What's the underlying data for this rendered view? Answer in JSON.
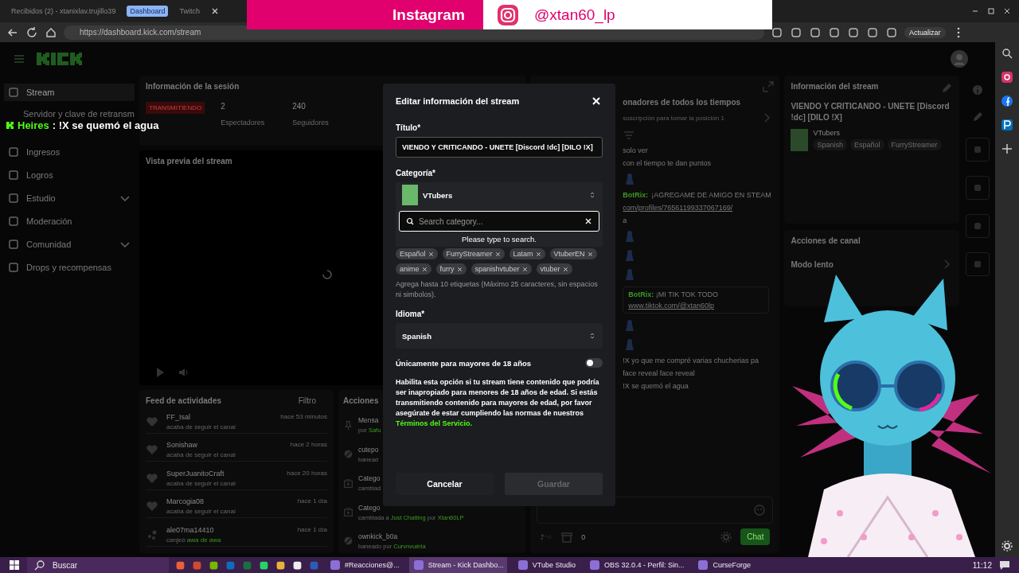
{
  "browser_tabs": [
    {
      "label": "Recibidos (2) - xtanixlav.trujillo39",
      "selected": false
    },
    {
      "label": "Dashboard",
      "selected": true
    },
    {
      "label": "Twitch",
      "selected": false
    }
  ],
  "address_bar": {
    "url": "https://dashboard.kick.com/stream"
  },
  "update_button": {
    "label": "Actualizar"
  },
  "overlay_banner": {
    "label": "Instagram",
    "handle": "@xtan60_lp"
  },
  "chat_overlay": {
    "user": "Heires",
    "message": ": !X se quemó el agua"
  },
  "sidebar": {
    "items": [
      {
        "label": "Stream",
        "selected": true,
        "submenu": false,
        "children": [
          {
            "label": "Servidor y clave de retransm"
          }
        ]
      },
      {
        "label": "Ingresos",
        "selected": false,
        "submenu": false
      },
      {
        "label": "Logros",
        "selected": false,
        "submenu": false
      },
      {
        "label": "Estudio",
        "selected": false,
        "submenu": true
      },
      {
        "label": "Moderación",
        "selected": false,
        "submenu": false
      },
      {
        "label": "Comunidad",
        "selected": false,
        "submenu": true
      },
      {
        "label": "Drops y recompensas",
        "selected": false,
        "submenu": false
      }
    ]
  },
  "session": {
    "title": "Información de la sesión",
    "status": "TRANSMITIENDO",
    "stats": [
      {
        "value": "2",
        "label": "Espectadores"
      },
      {
        "value": "240",
        "label": "Seguidores"
      }
    ]
  },
  "preview": {
    "title": "Vista previa del stream"
  },
  "feed": {
    "title": "Feed de actividades",
    "filter": "Filtro",
    "items": [
      {
        "kind": "follow",
        "user": "FF_Isal",
        "time": "hace 53 minutos",
        "detail": "acaba de seguir el canal"
      },
      {
        "kind": "follow",
        "user": "Sonishaw",
        "time": "hace 2 horas",
        "detail": "acaba de seguir el canal"
      },
      {
        "kind": "follow",
        "user": "SuperJuanitoCraft",
        "time": "hace 20 horas",
        "detail": "acaba de seguir el canal"
      },
      {
        "kind": "follow",
        "user": "Marcogia08",
        "time": "hace 1 día",
        "detail": "acaba de seguir el canal"
      },
      {
        "kind": "redeem",
        "user": "ale07ma14410",
        "time": "hace 1 día",
        "detail": "canjeó **awa de awa**"
      }
    ]
  },
  "actions": {
    "title": "Acciones",
    "items": [
      {
        "kind": "pin",
        "title": "Mensa",
        "detail": "por **Safu**"
      },
      {
        "kind": "ban",
        "title": "cutepo",
        "detail": "banead"
      },
      {
        "kind": "category",
        "title": "Catego",
        "detail": "cambiad"
      },
      {
        "kind": "category",
        "title": "Catego",
        "detail": "cambiada a **Just Chatting** por **Xtan60LP**"
      },
      {
        "kind": "ban",
        "title": "ownkick_b0a",
        "detail": "baneado por **Curvnvuéria**"
      }
    ]
  },
  "chat": {
    "header": "onadores de todos los tiempos",
    "subtitle": "suscripción para tomar la posición 1",
    "messages": [
      {
        "kind": "text",
        "text": "solo ver"
      },
      {
        "kind": "text",
        "text": "con el tiempo te dan puntos"
      },
      {
        "kind": "emote"
      },
      {
        "kind": "bot",
        "user": "BotRix:",
        "text": "¡AGREGAME DE AMIGO EN STEAM"
      },
      {
        "kind": "link",
        "text": "com/profiles/76561199337067169/"
      },
      {
        "kind": "text",
        "text": "a"
      },
      {
        "kind": "emote"
      },
      {
        "kind": "emote"
      },
      {
        "kind": "emote"
      },
      {
        "kind": "highlight",
        "user": "BotRix:",
        "text": "¡MI TIK TOK TODO",
        "link": "www.tiktok.com/@xtan60lp"
      },
      {
        "kind": "emote"
      },
      {
        "kind": "emote"
      },
      {
        "kind": "text",
        "text": "!X yo que me compré varias chucherias pa"
      },
      {
        "kind": "text",
        "text": "face reveal face reveal"
      },
      {
        "kind": "text",
        "text": "!X se quemó el agua"
      }
    ],
    "count": "0",
    "send": "Chat"
  },
  "stream_info": {
    "title": "Información del stream",
    "stream_title": "VIENDO Y CRITICANDO - UNETE [Discord !dc] [DILO !X]",
    "category": "VTubers",
    "tags": [
      "Spanish",
      "Español",
      "FurryStreamer"
    ]
  },
  "channel_actions": {
    "title": "Acciones de canal",
    "items": [
      {
        "label": "Modo lento"
      }
    ]
  },
  "modal": {
    "title": "Editar información del stream",
    "title_label": "Título*",
    "title_value": "VIENDO Y CRITICANDO - UNETE [Discord !dc] [DILO !X]",
    "category_label": "Categoría*",
    "category": "VTubers",
    "search": {
      "placeholder": "Search category...",
      "hint": "Please type to search."
    },
    "tags": [
      "Español",
      "FurryStreamer",
      "Latam",
      "VtuberEN",
      "anime",
      "furry",
      "spanishvtuber",
      "vtuber"
    ],
    "tags_help": "Agrega hasta 10 etiquetas (Máximo 25 caracteres, sin espacios ni simbolos).",
    "language_label": "Idioma*",
    "language": "Spanish",
    "mature": {
      "label": "Únicamente para mayores de 18 años",
      "on": false
    },
    "mature_help": "Habilita esta opción si tu stream tiene contenido que podría ser inapropiado para menores de 18 años de edad. Si estás transmitiendo contenido para mayores de edad, por favor asegúrate de estar cumpliendo las normas de nuestros",
    "terms_link": "Términos del Servicio.",
    "buttons": [
      {
        "label": "Cancelar",
        "disabled": false
      },
      {
        "label": "Guardar",
        "disabled": true
      }
    ]
  },
  "taskbar": {
    "search": "Buscar",
    "windows": [
      {
        "label": "#Reacciones@...",
        "selected": false
      },
      {
        "label": "Stream - Kick Dashbo...",
        "selected": true
      },
      {
        "label": "VTube Studio",
        "selected": false
      },
      {
        "label": "OBS 32.0.4 - Perfil: Sin...",
        "selected": false
      },
      {
        "label": "CurseForge",
        "selected": false
      }
    ],
    "clock": "11:12"
  }
}
